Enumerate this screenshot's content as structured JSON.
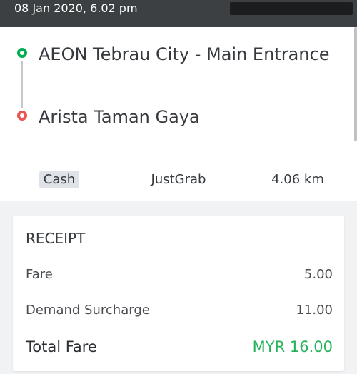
{
  "header": {
    "datetime": "08 Jan 2020, 6.02 pm"
  },
  "route": {
    "pickup": "AEON Tebrau City - Main Entrance",
    "dropoff": "Arista Taman Gaya"
  },
  "trip_info": {
    "payment": "Cash",
    "service": "JustGrab",
    "distance": "4.06 km"
  },
  "receipt": {
    "title": "RECEIPT",
    "rows": [
      {
        "label": "Fare",
        "amount": "5.00"
      },
      {
        "label": "Demand Surcharge",
        "amount": "11.00"
      }
    ],
    "total_label": "Total Fare",
    "total_amount": "MYR 16.00"
  },
  "colors": {
    "pickup_dot": "#00b14f",
    "dropoff_dot": "#ee5353",
    "total_amount": "#26b25a",
    "header_bg": "#3c4043"
  }
}
